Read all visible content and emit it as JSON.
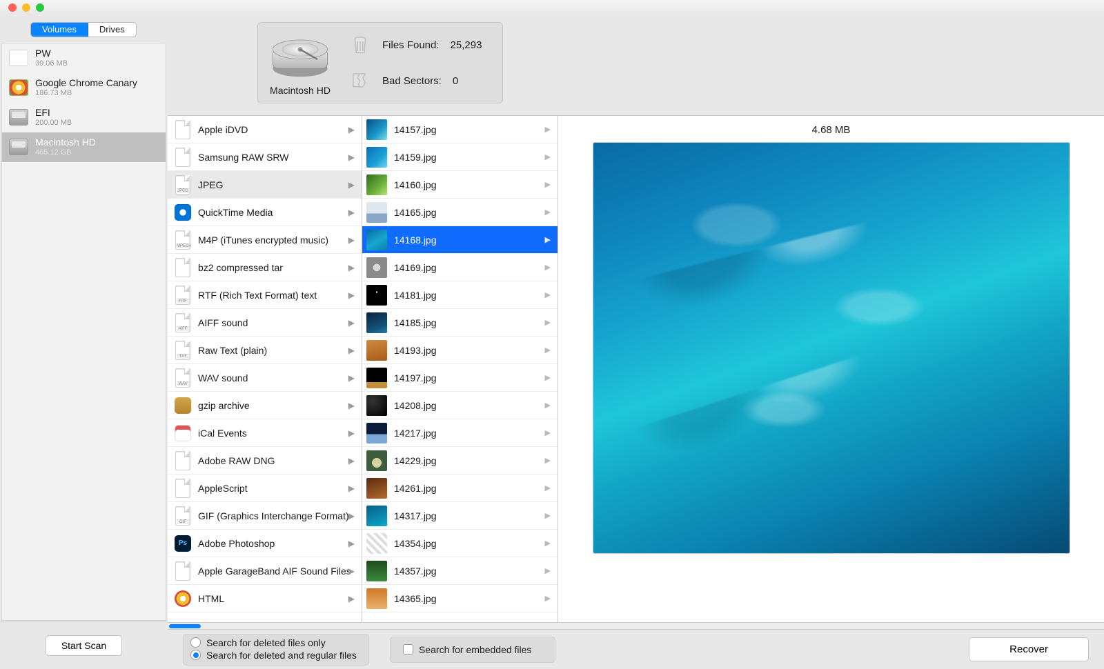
{
  "titlebar": {
    "close": "close",
    "min": "minimize",
    "max": "zoom"
  },
  "sidebar": {
    "segments": {
      "volumes": "Volumes",
      "drives": "Drives",
      "active": 0
    },
    "volumes": [
      {
        "name": "PW",
        "sub": "39.06 MB",
        "icon": "white",
        "selected": false
      },
      {
        "name": "Google Chrome Canary",
        "sub": "186.73 MB",
        "icon": "chrome",
        "selected": false
      },
      {
        "name": "EFI",
        "sub": "200.00 MB",
        "icon": "disk",
        "selected": false
      },
      {
        "name": "Macintosh HD",
        "sub": "465.12 GB",
        "icon": "disk",
        "selected": true
      }
    ],
    "start_scan": "Start Scan"
  },
  "header": {
    "drive_label": "Macintosh HD",
    "files_found_label": "Files Found:",
    "files_found_value": "25,293",
    "bad_sectors_label": "Bad Sectors:",
    "bad_sectors_value": "0"
  },
  "types": [
    {
      "label": "Apple iDVD",
      "icon": "doc",
      "tag": ""
    },
    {
      "label": "Samsung RAW SRW",
      "icon": "doc",
      "tag": ""
    },
    {
      "label": "JPEG",
      "icon": "doc",
      "tag": "JPEG",
      "selected": true
    },
    {
      "label": "QuickTime Media",
      "icon": "app",
      "app": "mov"
    },
    {
      "label": "M4P (iTunes encrypted music)",
      "icon": "doc",
      "tag": "MPEG4"
    },
    {
      "label": "bz2 compressed tar",
      "icon": "doc",
      "tag": ""
    },
    {
      "label": "RTF (Rich Text Format) text",
      "icon": "doc",
      "tag": "RTF"
    },
    {
      "label": "AIFF sound",
      "icon": "doc",
      "tag": "AIFF"
    },
    {
      "label": "Raw Text (plain)",
      "icon": "doc",
      "tag": "TXT"
    },
    {
      "label": "WAV sound",
      "icon": "doc",
      "tag": "WAV"
    },
    {
      "label": "gzip archive",
      "icon": "app",
      "app": "gz"
    },
    {
      "label": "iCal Events",
      "icon": "app",
      "app": "ics"
    },
    {
      "label": "Adobe RAW DNG",
      "icon": "doc",
      "tag": ""
    },
    {
      "label": "AppleScript",
      "icon": "doc",
      "tag": ""
    },
    {
      "label": "GIF (Graphics Interchange Format)",
      "icon": "doc",
      "tag": "GIF"
    },
    {
      "label": "Adobe Photoshop",
      "icon": "app",
      "app": "ps"
    },
    {
      "label": "Apple GarageBand AIF Sound Files",
      "icon": "doc",
      "tag": ""
    },
    {
      "label": "HTML",
      "icon": "app",
      "app": "html"
    }
  ],
  "files": [
    {
      "name": "14157.jpg",
      "thumb": "linear-gradient(135deg,#0b4f8a,#1898c8 60%,#84dfe8)"
    },
    {
      "name": "14159.jpg",
      "thumb": "linear-gradient(135deg,#0a6fb5,#1aa0d6 60%,#6fd5ef)"
    },
    {
      "name": "14160.jpg",
      "thumb": "linear-gradient(135deg,#2f6b1e,#6bb13b 60%,#b9e27a)"
    },
    {
      "name": "14165.jpg",
      "thumb": "linear-gradient(180deg,#dfe7ef 0 55%,#8aa8c6 55% 100%)"
    },
    {
      "name": "14168.jpg",
      "thumb": "linear-gradient(150deg,#0a6aa3,#17a7cf 55%,#0a7fae)",
      "selected": true
    },
    {
      "name": "14169.jpg",
      "thumb": "radial-gradient(circle at 50% 50%,#d9d9d9 0 25%,#8a8a8a 25% 100%)"
    },
    {
      "name": "14181.jpg",
      "thumb": "radial-gradient(circle at 50% 35%,#fff 0 5%,#000 5% 100%)"
    },
    {
      "name": "14185.jpg",
      "thumb": "linear-gradient(160deg,#09203f,#13547a 70%,#2c7da0)"
    },
    {
      "name": "14193.jpg",
      "thumb": "linear-gradient(170deg,#d08b3e,#a85a1b)"
    },
    {
      "name": "14197.jpg",
      "thumb": "linear-gradient(180deg,#000 0 70%,#c28d3a 70% 100%)"
    },
    {
      "name": "14208.jpg",
      "thumb": "radial-gradient(circle at 30% 30%,#333,#000)"
    },
    {
      "name": "14217.jpg",
      "thumb": "linear-gradient(180deg,#0b1b3a 0 55%,#7aa7d6 55% 100%)"
    },
    {
      "name": "14229.jpg",
      "thumb": "radial-gradient(circle at 50% 60%,#d7d3a0 0 30%,#3e5c3e 30% 100%)"
    },
    {
      "name": "14261.jpg",
      "thumb": "linear-gradient(160deg,#5a2a10,#b56a2f)"
    },
    {
      "name": "14317.jpg",
      "thumb": "linear-gradient(160deg,#065f8a,#0fa7c8)"
    },
    {
      "name": "14354.jpg",
      "thumb": "repeating-linear-gradient(45deg,#fff 0 4px,#ddd 4px 8px)"
    },
    {
      "name": "14357.jpg",
      "thumb": "linear-gradient(180deg,#1b4d1b,#3f8a3f)"
    },
    {
      "name": "14365.jpg",
      "thumb": "linear-gradient(180deg,#d07a28,#e7b26a)"
    }
  ],
  "preview": {
    "size": "4.68 MB"
  },
  "bottom": {
    "radio_deleted_only": "Search for deleted files only",
    "radio_deleted_regular": "Search for deleted and regular files",
    "radio_selected": 1,
    "checkbox_embedded": "Search for embedded files",
    "checkbox_embedded_checked": false,
    "recover": "Recover"
  }
}
